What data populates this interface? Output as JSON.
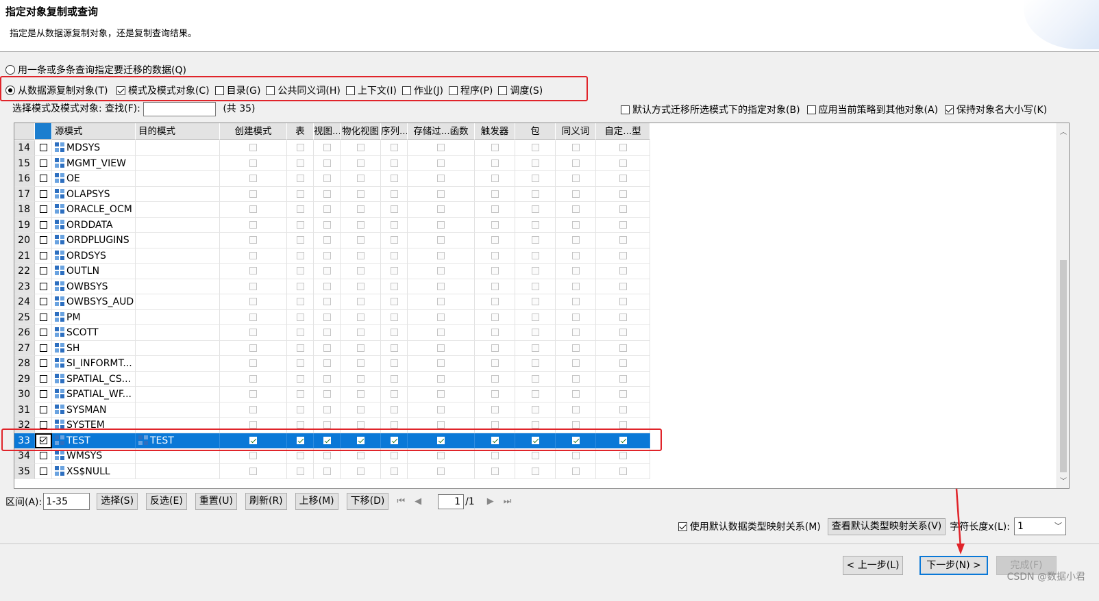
{
  "header": {
    "title": "指定对象复制或查询",
    "subtitle": "指定是从数据源复制对象，还是复制查询结果。"
  },
  "source_options": {
    "query_option": "用一条或多条查询指定要迁移的数据(Q)",
    "copy_option": "从数据源复制对象(T)",
    "object_types": [
      "模式及模式对象(C)",
      "目录(G)",
      "公共同义词(H)",
      "上下文(I)",
      "作业(J)",
      "程序(P)",
      "调度(S)"
    ],
    "object_types_checked": [
      true,
      false,
      false,
      false,
      false,
      false,
      false
    ]
  },
  "filter": {
    "label": "选择模式及模式对象:",
    "find_label": "查找(F):",
    "find_value": "",
    "count_text": "(共 35)"
  },
  "right_options": [
    {
      "label": "默认方式迁移所选模式下的指定对象(B)",
      "checked": false
    },
    {
      "label": "应用当前策略到其他对象(A)",
      "checked": false
    },
    {
      "label": "保持对象名大小写(K)",
      "checked": true
    }
  ],
  "grid": {
    "columns": [
      "源模式",
      "目的模式",
      "创建模式",
      "表",
      "视图...",
      "物化视图",
      "序列...",
      "存储过...函数",
      "触发器",
      "包",
      "同义词",
      "自定...型"
    ],
    "rows": [
      {
        "num": "14",
        "source": "MDSYS",
        "target": "",
        "checked": false,
        "selected": false
      },
      {
        "num": "15",
        "source": "MGMT_VIEW",
        "target": "",
        "checked": false,
        "selected": false
      },
      {
        "num": "16",
        "source": "OE",
        "target": "",
        "checked": false,
        "selected": false
      },
      {
        "num": "17",
        "source": "OLAPSYS",
        "target": "",
        "checked": false,
        "selected": false
      },
      {
        "num": "18",
        "source": "ORACLE_OCM",
        "target": "",
        "checked": false,
        "selected": false
      },
      {
        "num": "19",
        "source": "ORDDATA",
        "target": "",
        "checked": false,
        "selected": false
      },
      {
        "num": "20",
        "source": "ORDPLUGINS",
        "target": "",
        "checked": false,
        "selected": false
      },
      {
        "num": "21",
        "source": "ORDSYS",
        "target": "",
        "checked": false,
        "selected": false
      },
      {
        "num": "22",
        "source": "OUTLN",
        "target": "",
        "checked": false,
        "selected": false
      },
      {
        "num": "23",
        "source": "OWBSYS",
        "target": "",
        "checked": false,
        "selected": false
      },
      {
        "num": "24",
        "source": "OWBSYS_AUD",
        "target": "",
        "checked": false,
        "selected": false
      },
      {
        "num": "25",
        "source": "PM",
        "target": "",
        "checked": false,
        "selected": false
      },
      {
        "num": "26",
        "source": "SCOTT",
        "target": "",
        "checked": false,
        "selected": false
      },
      {
        "num": "27",
        "source": "SH",
        "target": "",
        "checked": false,
        "selected": false
      },
      {
        "num": "28",
        "source": "SI_INFORMT...",
        "target": "",
        "checked": false,
        "selected": false
      },
      {
        "num": "29",
        "source": "SPATIAL_CS...",
        "target": "",
        "checked": false,
        "selected": false
      },
      {
        "num": "30",
        "source": "SPATIAL_WF...",
        "target": "",
        "checked": false,
        "selected": false
      },
      {
        "num": "31",
        "source": "SYSMAN",
        "target": "",
        "checked": false,
        "selected": false
      },
      {
        "num": "32",
        "source": "SYSTEM",
        "target": "",
        "checked": false,
        "selected": false
      },
      {
        "num": "33",
        "source": "TEST",
        "target": "TEST",
        "checked": true,
        "selected": true
      },
      {
        "num": "34",
        "source": "WMSYS",
        "target": "",
        "checked": false,
        "selected": false
      },
      {
        "num": "35",
        "source": "XS$NULL",
        "target": "",
        "checked": false,
        "selected": false
      }
    ]
  },
  "paging": {
    "range_label": "区间(A):",
    "range_value": "1-35",
    "buttons": [
      "选择(S)",
      "反选(E)",
      "重置(U)",
      "刷新(R)",
      "上移(M)",
      "下移(D)"
    ],
    "page_value": "1",
    "page_total": "/1"
  },
  "mapping": {
    "use_default_label": "使用默认数据类型映射关系(M)",
    "use_default_checked": true,
    "view_button": "查看默认类型映射关系(V)",
    "charlen_label": "字符长度x(L):",
    "charlen_value": "1"
  },
  "wizard": {
    "back": "< 上一步(L)",
    "next": "下一步(N) >",
    "finish": "完成(F)"
  },
  "watermark": "CSDN @数据小君",
  "colors": {
    "selection": "#0a78d7",
    "annotation_red": "#e0242a"
  }
}
